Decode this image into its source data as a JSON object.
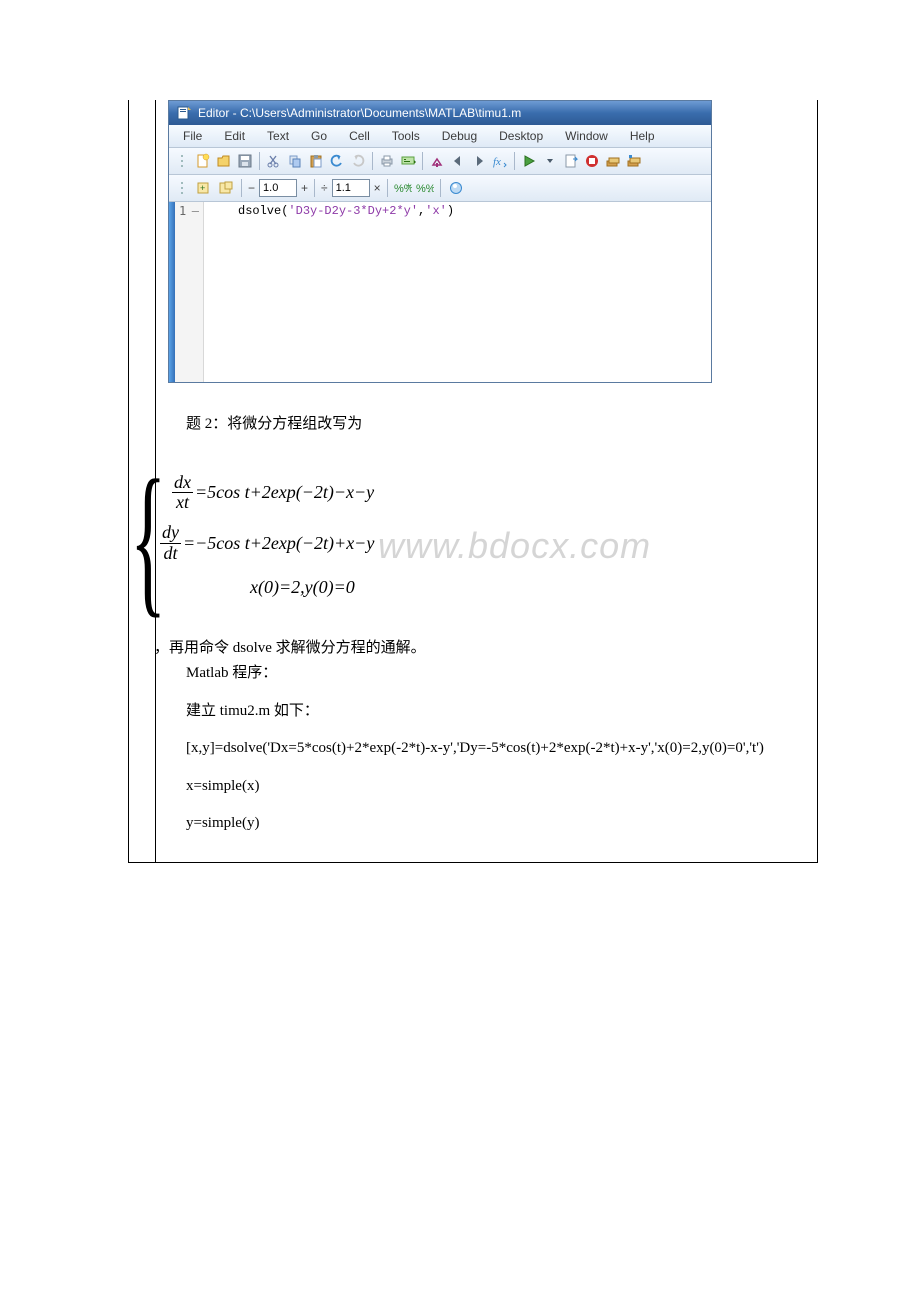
{
  "editor": {
    "title": "Editor - C:\\Users\\Administrator\\Documents\\MATLAB\\timu1.m",
    "menus": [
      "File",
      "Edit",
      "Text",
      "Go",
      "Cell",
      "Tools",
      "Debug",
      "Desktop",
      "Window",
      "Help"
    ],
    "cell_val1": "1.0",
    "cell_val2": "1.1",
    "line_no": "1",
    "dash": "–",
    "code_fn": "dsolve",
    "code_paren_open": "(",
    "code_str1": "'D3y-D2y-3*Dy+2*y'",
    "code_comma": ",",
    "code_str2": "'x'",
    "code_paren_close": ")"
  },
  "text": {
    "q2_label": "题 2：将微分方程组改写为",
    "eq1_lhs_num": "dx",
    "eq1_lhs_den": "xt",
    "eq1_rhs": "=5cos t+2exp(−2t)−x−y",
    "eq2_lhs_num": "dy",
    "eq2_lhs_den": "dt",
    "eq2_rhs": "=−5cos t+2exp(−2t)+x−y",
    "eq3": "x(0)=2,y(0)=0",
    "watermark": "www.bdocx.com",
    "p1": "，再用命令 dsolve 求解微分方程的通解。",
    "p2": "Matlab 程序：",
    "p3": "建立 timu2.m 如下：",
    "p4": "[x,y]=dsolve('Dx=5*cos(t)+2*exp(-2*t)-x-y','Dy=-5*cos(t)+2*exp(-2*t)+x-y','x(0)=2,y(0)=0','t')",
    "p5": "x=simple(x)",
    "p6": "y=simple(y)"
  }
}
